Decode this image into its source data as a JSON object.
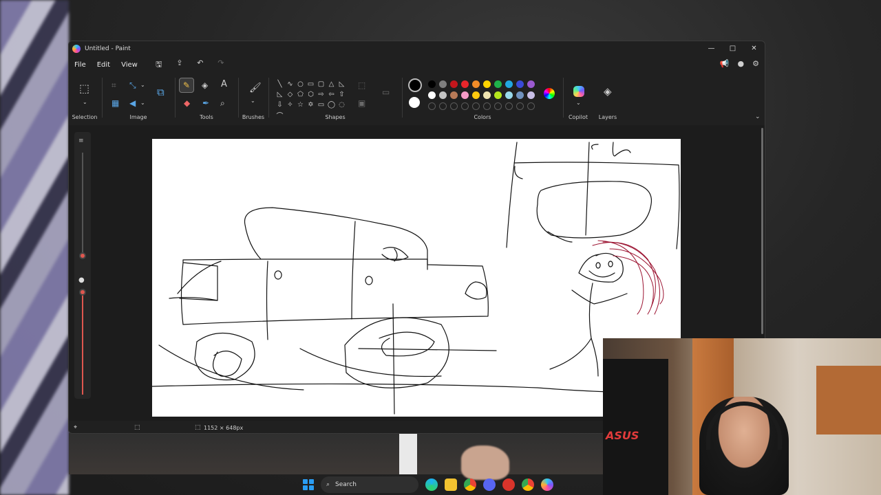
{
  "window": {
    "title": "Untitled - Paint",
    "controls": {
      "minimize": "—",
      "maximize": "□",
      "close": "✕"
    }
  },
  "menu": {
    "file": "File",
    "edit": "Edit",
    "view": "View"
  },
  "ribbon": {
    "selection_label": "Selection",
    "image_label": "Image",
    "tools_label": "Tools",
    "brushes_label": "Brushes",
    "shapes_label": "Shapes",
    "colors_label": "Colors",
    "copilot_label": "Copilot",
    "layers_label": "Layers",
    "text_tool_glyph": "A",
    "shapes": [
      "╲",
      "∿",
      "○",
      "▭",
      "▢",
      "△",
      "◺",
      "◺",
      "◇",
      "⬠",
      "⬡",
      "⇨",
      "⇦",
      "⇧",
      "⇩",
      "✧",
      "☆",
      "✡",
      "▭",
      "◯",
      "◌",
      "⌒"
    ],
    "current_color": "#000000",
    "secondary_color": "#ffffff",
    "palette_row1": [
      "#000000",
      "#7f7f7f",
      "#c3161c",
      "#e8262b",
      "#f28c28",
      "#ffd400",
      "#1fb24a",
      "#22a7e0",
      "#3a4ad6",
      "#9b59d0"
    ],
    "palette_row2": [
      "#ffffff",
      "#c3c3c3",
      "#b97a57",
      "#f59bc6",
      "#ffc90e",
      "#efe4b0",
      "#b5e61d",
      "#99d9ea",
      "#7092be",
      "#c8bfe7"
    ]
  },
  "status": {
    "canvas_size": "1152 × 648px"
  },
  "webcam": {
    "brand": "ASUS"
  },
  "taskbar": {
    "search": "Search"
  }
}
